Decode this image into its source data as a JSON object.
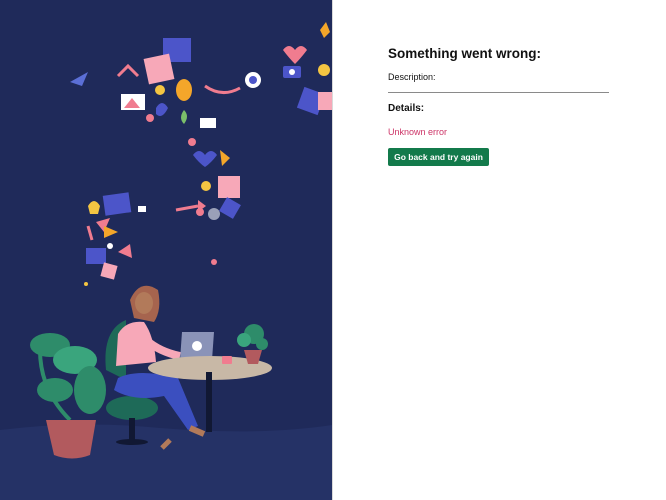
{
  "error_page": {
    "title": "Something went wrong:",
    "description_label": "Description:",
    "description_value": "",
    "details_label": "Details:",
    "error_message": "Unknown error",
    "retry_button_label": "Go back and try again"
  },
  "colors": {
    "illustration_background": "#1f2a5a",
    "button_background": "#137a4b",
    "error_text": "#cc3366"
  }
}
